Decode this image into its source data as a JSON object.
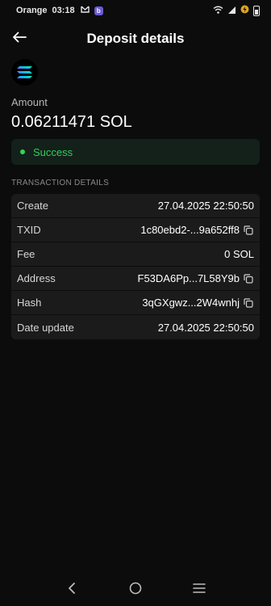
{
  "status_bar": {
    "carrier": "Orange",
    "time": "03:18",
    "app_badge": "b"
  },
  "header": {
    "title": "Deposit details",
    "back_icon": "arrow-left-icon"
  },
  "coin": {
    "icon": "solana-logo",
    "colors": [
      "#9945ff",
      "#19fb9b",
      "#00c2ff"
    ]
  },
  "amount": {
    "label": "Amount",
    "value": "0.06211471 SOL"
  },
  "status": {
    "text": "Success",
    "color": "#33cc5e",
    "background": "#13211a"
  },
  "details": {
    "section_title": "TRANSACTION DETAILS",
    "rows": [
      {
        "label": "Create",
        "value": "27.04.2025 22:50:50",
        "copy": false
      },
      {
        "label": "TXID",
        "value": "1c80ebd2-...9a652ff8",
        "copy": true
      },
      {
        "label": "Fee",
        "value": "0 SOL",
        "copy": false
      },
      {
        "label": "Address",
        "value": "F53DA6Pp...7L58Y9b",
        "copy": true
      },
      {
        "label": "Hash",
        "value": "3qGXgwz...2W4wnhj",
        "copy": true
      },
      {
        "label": "Date update",
        "value": "27.04.2025 22:50:50",
        "copy": false
      }
    ]
  },
  "nav": {
    "back": "chevron-left-icon",
    "home": "circle-home-icon",
    "recents": "menu-lines-icon"
  }
}
